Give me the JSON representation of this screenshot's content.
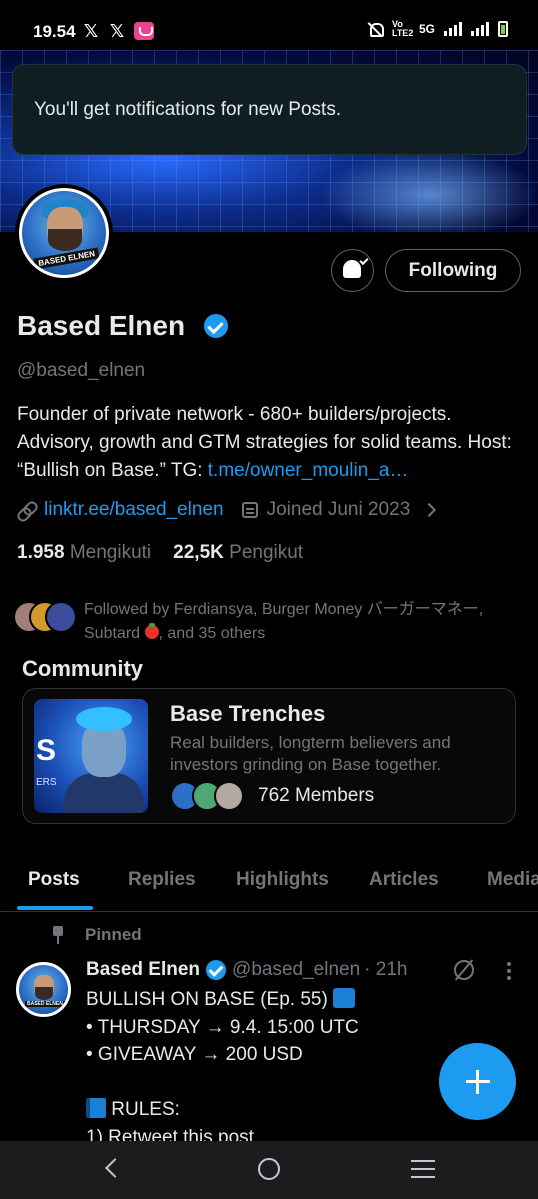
{
  "status_bar": {
    "time": "19.54",
    "x_icon_glyph": "𝕏",
    "network_label": "5G",
    "volte_label": "Vo LTE2",
    "icons": [
      "x-logo-icon",
      "x-logo-icon",
      "app-notification-icon",
      "bell-off-icon",
      "signal-icon",
      "battery-icon"
    ]
  },
  "toast": {
    "text": "You'll get notifications for new Posts."
  },
  "profile": {
    "avatar_label": "BASED ELNEN",
    "following_label": "Following",
    "display_name": "Based Elnen",
    "handle": "@based_elnen",
    "bio_text": "Founder of private network - 680+ builders/projects. Advisory, growth and GTM strategies for solid teams. Host: “Bullish on Base.” TG: ",
    "bio_link": "t.me/owner_moulin_a…",
    "website": "linktr.ee/based_elnen",
    "joined": "Joined Juni 2023",
    "following_count": "1.958",
    "following_label_text": "Mengikuti",
    "followers_count": "22,5K",
    "followers_label_text": "Pengikut",
    "followed_by_text": "Followed by Ferdiansya, Burger Money バーガーマネー, Subtard",
    "followed_by_suffix": ", and 35 others"
  },
  "community": {
    "section_title": "Community",
    "image_letter": "S",
    "image_sub": "ERS",
    "name": "Base Trenches",
    "description": "Real builders, longterm believers and investors grinding on Base together.",
    "members": "762 Members"
  },
  "tabs": [
    {
      "label": "Posts",
      "active": true
    },
    {
      "label": "Replies",
      "active": false
    },
    {
      "label": "Highlights",
      "active": false
    },
    {
      "label": "Articles",
      "active": false
    },
    {
      "label": "Media",
      "active": false
    }
  ],
  "post": {
    "pinned_label": "Pinned",
    "author_name": "Based Elnen",
    "author_handle": "@based_elnen",
    "time": "· 21h",
    "line1": "BULLISH ON BASE (Ep. 55) ",
    "line2": "• THURSDAY → 9.4. 15:00 UTC",
    "line3": "• GIVEAWAY → 200 USD",
    "line4": " RULES:",
    "line5": "1) Retweet this post",
    "avatar_label": "BASED ELNEN"
  },
  "colors": {
    "accent": "#1d9bf0",
    "background": "#000000",
    "text_primary": "#e7e9ea",
    "text_secondary": "#71767b"
  }
}
